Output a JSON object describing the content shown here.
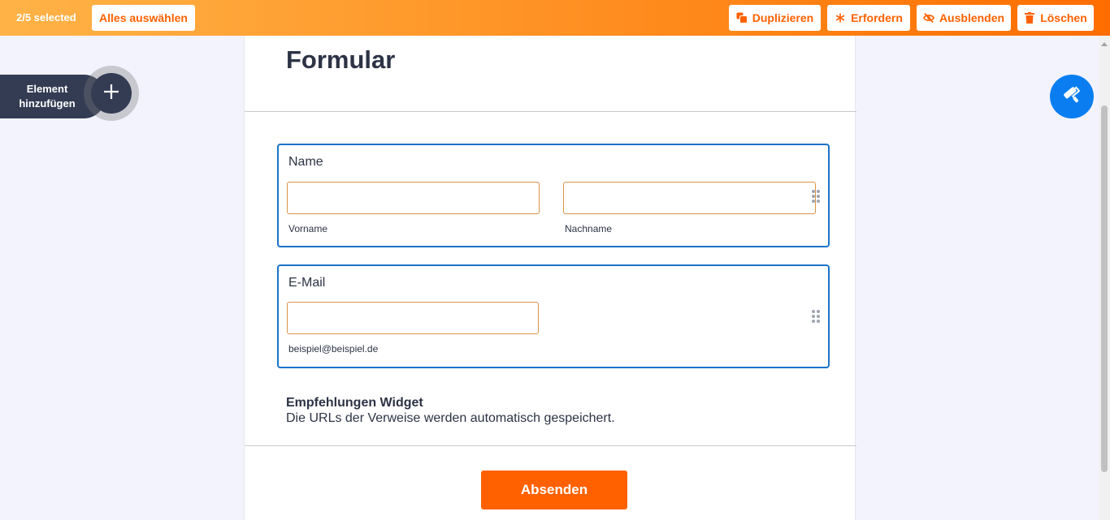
{
  "toolbar": {
    "selected_count": "2/5 selected",
    "select_all_label": "Alles auswählen",
    "duplicate_label": "Duplizieren",
    "require_label": "Erfordern",
    "hide_label": "Ausblenden",
    "delete_label": "Löschen"
  },
  "sidebar": {
    "add_element_label_line1": "Element",
    "add_element_label_line2": "hinzufügen"
  },
  "form": {
    "title": "Formular",
    "name_field": {
      "label": "Name",
      "first_sublabel": "Vorname",
      "last_sublabel": "Nachname"
    },
    "email_field": {
      "label": "E-Mail",
      "sublabel": "beispiel@beispiel.de"
    },
    "widget": {
      "title": "Empfehlungen Widget",
      "description": "Die URLs der Verweise werden automatisch gespeichert."
    },
    "submit_label": "Absenden"
  },
  "colors": {
    "accent": "#ff6100",
    "selection_border": "#1b74c9",
    "paint_button": "#0a7ef0",
    "sidebar_dark": "#343c54"
  },
  "icons": [
    "duplicate-icon",
    "asterisk-icon",
    "eye-off-icon",
    "trash-icon",
    "plus-icon",
    "paint-roller-icon",
    "drag-handle-icon"
  ]
}
